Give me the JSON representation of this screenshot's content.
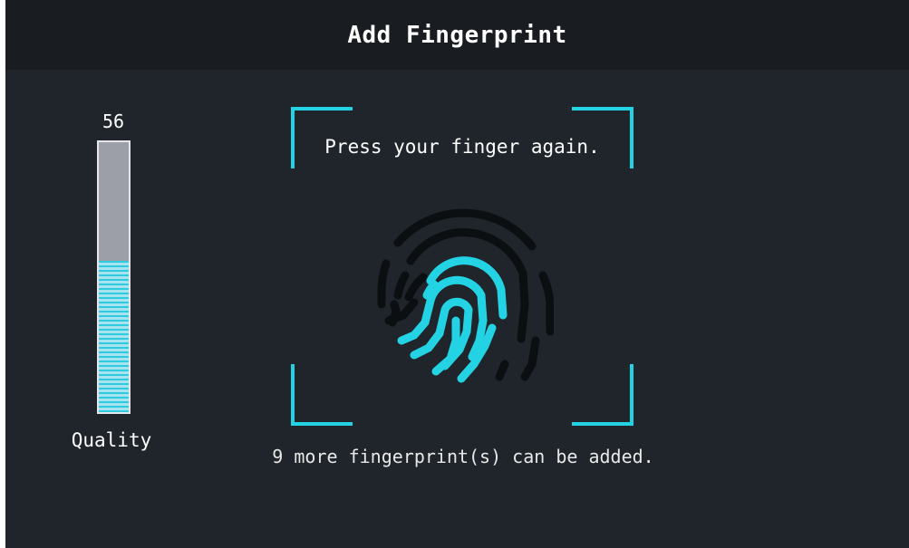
{
  "header": {
    "title": "Add Fingerprint"
  },
  "quality": {
    "value": "56",
    "label": "Quality",
    "fill_fraction": 0.56
  },
  "scan": {
    "prompt": "Press your finger again.",
    "remaining_text": "9 more fingerprint(s) can be added."
  },
  "colors": {
    "background": "#1f252b",
    "header_background": "#191d21",
    "accent": "#23d3e3",
    "fingerprint_dark": "#0c0f12"
  },
  "icons": {
    "fingerprint": "fingerprint-icon"
  }
}
